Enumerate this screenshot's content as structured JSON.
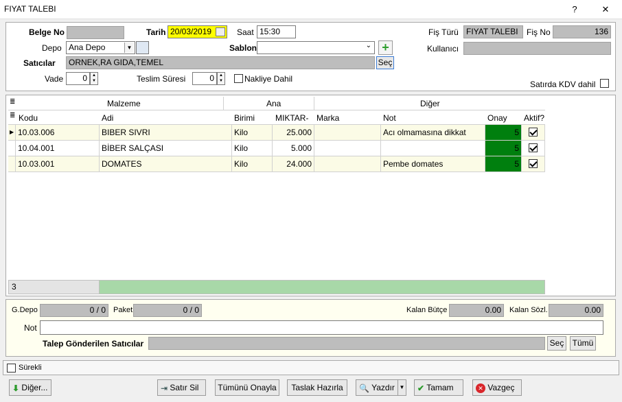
{
  "window": {
    "title": "FIYAT TALEBI",
    "help_glyph": "?",
    "close_glyph": "✕"
  },
  "header": {
    "belge_no_label": "Belge No",
    "belge_no_value": "",
    "tarih_label": "Tarih",
    "tarih_value": "20/03/2019",
    "saat_label": "Saat",
    "saat_value": "15:30",
    "fis_turu_label": "Fiş Türü",
    "fis_turu_value": "FIYAT TALEBI",
    "fis_no_label": "Fiş No",
    "fis_no_value": "136",
    "depo_label": "Depo",
    "depo_value": "Ana Depo",
    "sablon_label": "Sablon",
    "sablon_value": "",
    "kullanici_label": "Kullanıcı",
    "kullanici_value": "",
    "saticilar_label": "Satıcılar",
    "saticilar_value": "ORNEK,RA GIDA,TEMEL",
    "sec_label": "Seç",
    "vade_label": "Vade",
    "vade_value": "0",
    "teslim_label": "Teslim Süresi",
    "teslim_value": "0",
    "nakliye_label": "Nakliye Dahil",
    "kdv_label": "Satırda KDV dahil"
  },
  "grid": {
    "group_headers": [
      "Malzeme",
      "Ana",
      "Diğer"
    ],
    "columns": [
      "Kodu",
      "Adi",
      "Birimi",
      "MIKTAR-",
      "Marka",
      "Not",
      "Onay",
      "Aktif?"
    ],
    "rows": [
      {
        "kodu": "10.03.006",
        "adi": "BIBER SIVRI",
        "birimi": "Kilo",
        "miktar": "25.000",
        "marka": "",
        "not": "Acı olmamasına dikkat",
        "onay": "5"
      },
      {
        "kodu": "10.04.001",
        "adi": "BİBER SALÇASI",
        "birimi": "Kilo",
        "miktar": "5.000",
        "marka": "",
        "not": "",
        "onay": "5"
      },
      {
        "kodu": "10.03.001",
        "adi": "DOMATES",
        "birimi": "Kilo",
        "miktar": "24.000",
        "marka": "",
        "not": "Pembe domates",
        "onay": "5"
      }
    ],
    "footer_count": "3"
  },
  "bottom": {
    "gdepo_label": "G.Depo",
    "gdepo_value": "0 / 0",
    "paket_label": "Paket",
    "paket_value": "0 / 0",
    "kalan_butce_label": "Kalan Bütçe",
    "kalan_butce_value": "0.00",
    "kalan_sozl_label": "Kalan Sözl.",
    "kalan_sozl_value": "0.00",
    "not_label": "Not",
    "not_value": "",
    "talep_label": "Talep Gönderilen Satıcılar",
    "talep_value": "",
    "sec_label": "Seç",
    "tumu_label": "Tümü"
  },
  "surekli_label": "Sürekli",
  "toolbar": {
    "diger": "Diğer...",
    "satir_sil": "Satır Sil",
    "tumunu_onayla": "Tümünü Onayla",
    "taslak": "Taslak Hazırla",
    "yazdir": "Yazdır",
    "tamam": "Tamam",
    "vazgec": "Vazgeç"
  }
}
